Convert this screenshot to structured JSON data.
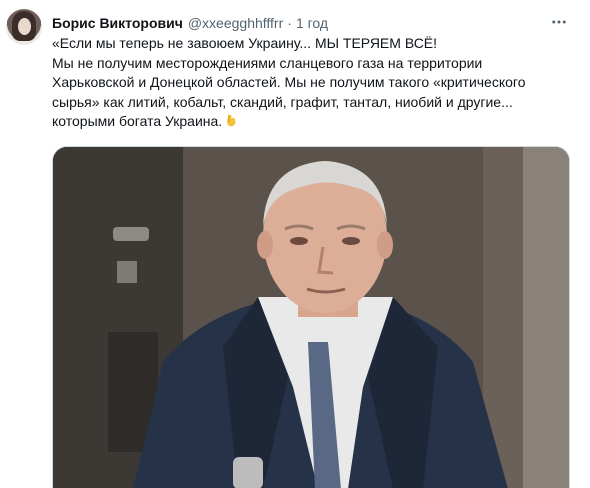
{
  "tweet": {
    "author_name": "Борис Викторович",
    "author_handle": "@xxeegghhfffrr",
    "separator": "·",
    "time": "1 год",
    "text_lines": [
      "«Если мы теперь не завоюем Украину... МЫ ТЕРЯЕМ ВСЁ!",
      "Мы не получим месторождениями сланцевого газа на территории",
      "Харьковской и Донецкой областей. Мы не получим такого «критического",
      "сырья» как литий, кобальт, скандий, графит, тантал, ниобий и другие...",
      "которыми богата Украина."
    ],
    "emoji_icon": "pointing-down-hand-icon",
    "more_icon": "more-options-icon",
    "avatar_icon": "user-avatar"
  },
  "colors": {
    "text": "#0f1419",
    "secondary": "#536471",
    "border": "#cfd9de"
  }
}
